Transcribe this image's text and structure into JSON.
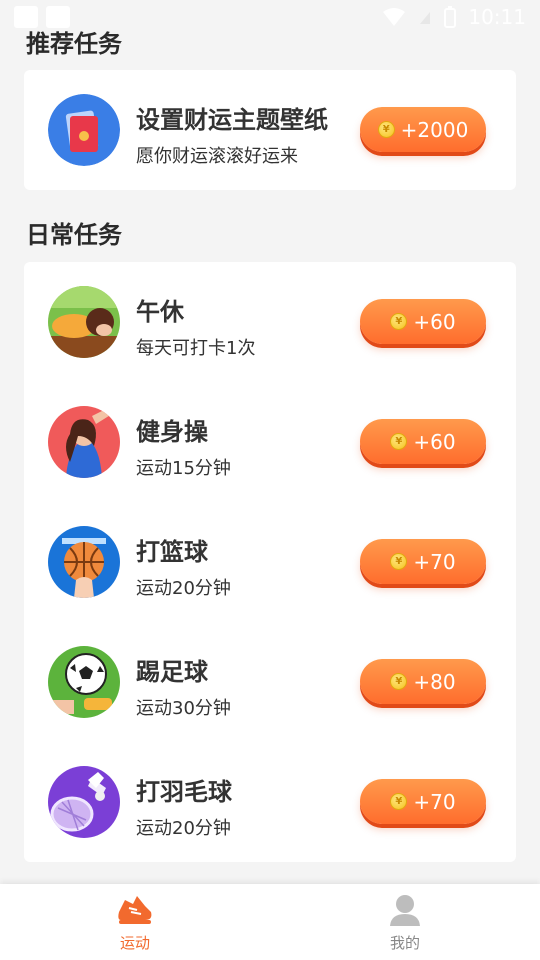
{
  "status_bar": {
    "time": "10:11"
  },
  "recommended": {
    "title": "推荐任务",
    "task": {
      "name": "设置财运主题壁纸",
      "desc": "愿你财运滚滚好运来",
      "reward": "+2000"
    }
  },
  "daily": {
    "title": "日常任务",
    "tasks": [
      {
        "name": "午休",
        "desc": "每天可打卡1次",
        "reward": "+60",
        "icon": "nap-icon"
      },
      {
        "name": "健身操",
        "desc": "运动15分钟",
        "reward": "+60",
        "icon": "aerobics-icon"
      },
      {
        "name": "打篮球",
        "desc": "运动20分钟",
        "reward": "+70",
        "icon": "basketball-icon"
      },
      {
        "name": "踢足球",
        "desc": "运动30分钟",
        "reward": "+80",
        "icon": "soccer-icon"
      },
      {
        "name": "打羽毛球",
        "desc": "运动20分钟",
        "reward": "+70",
        "icon": "badminton-icon"
      }
    ]
  },
  "coin_symbol": "¥",
  "bottom_nav": [
    {
      "label": "运动",
      "icon": "sneaker-icon",
      "active": true
    },
    {
      "label": "我的",
      "icon": "user-icon",
      "active": false
    }
  ],
  "colors": {
    "accent": "#ff6d2d",
    "active_nav": "#f26a2e",
    "inactive_nav": "#888888"
  }
}
